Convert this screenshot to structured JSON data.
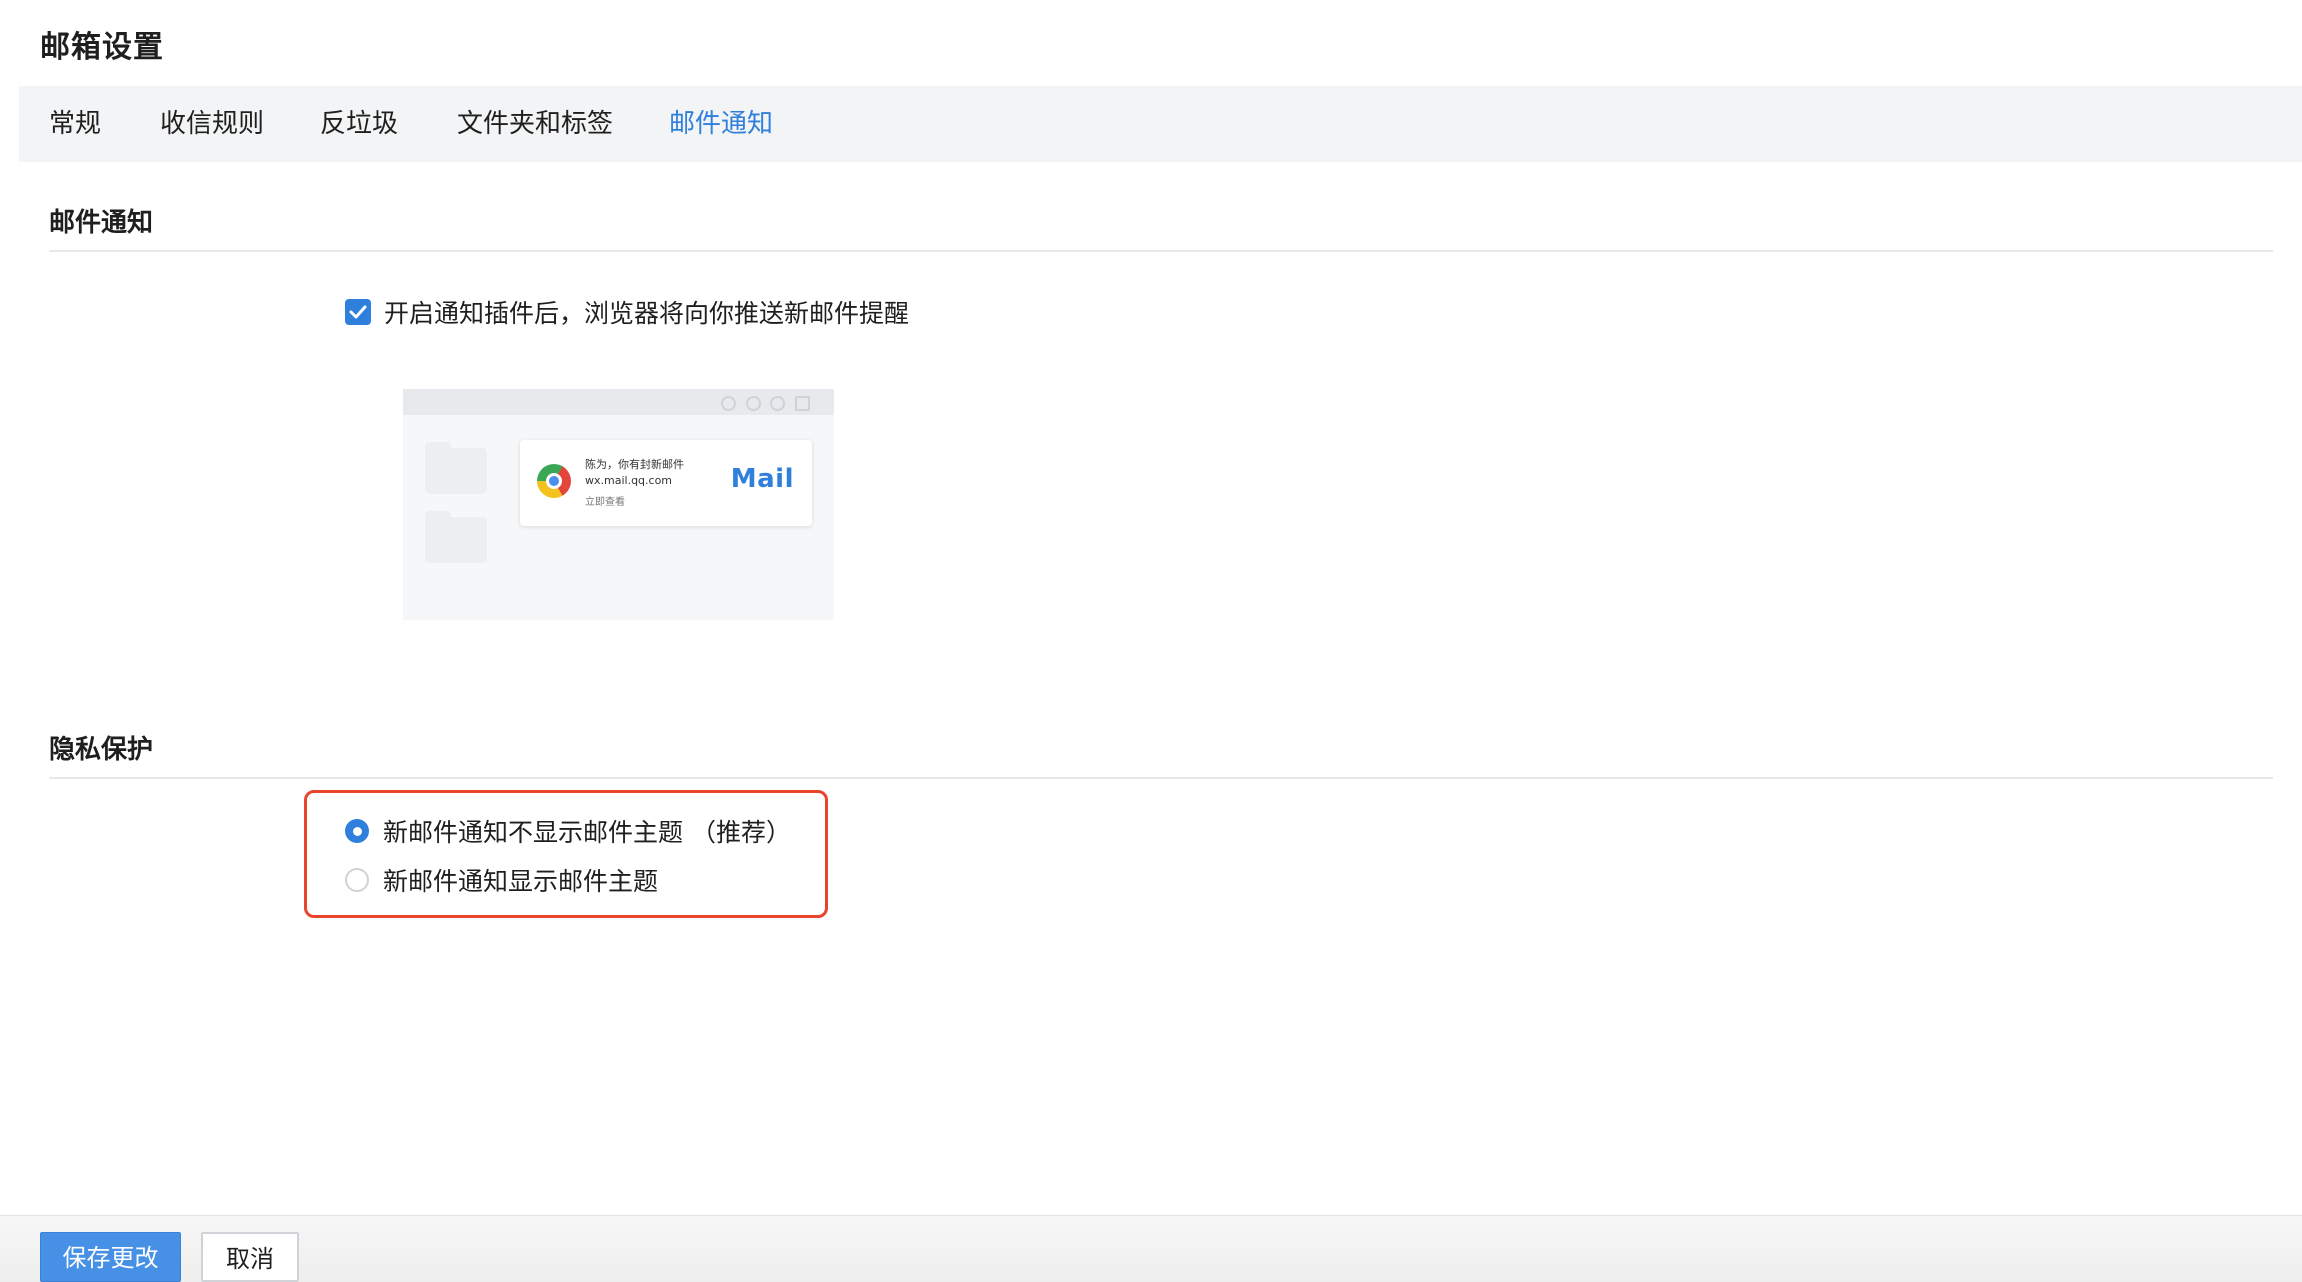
{
  "page": {
    "title": "邮箱设置"
  },
  "tabs": [
    {
      "label": "常规",
      "active": false
    },
    {
      "label": "收信规则",
      "active": false
    },
    {
      "label": "反垃圾",
      "active": false
    },
    {
      "label": "文件夹和标签",
      "active": false
    },
    {
      "label": "邮件通知",
      "active": true
    }
  ],
  "notification_section": {
    "title": "邮件通知",
    "checkbox": {
      "checked": true,
      "label": "开启通知插件后，浏览器将向你推送新邮件提醒"
    },
    "preview": {
      "line1": "陈为，你有封新邮件",
      "line2": "wx.mail.qq.com",
      "line3": "立即查看",
      "logo_text": "Mail",
      "browser_icon": "chrome-icon"
    }
  },
  "privacy_section": {
    "title": "隐私保护",
    "options": [
      {
        "label": "新邮件通知不显示邮件主题 （推荐）",
        "selected": true
      },
      {
        "label": "新邮件通知显示邮件主题",
        "selected": false
      }
    ]
  },
  "footer": {
    "save_label": "保存更改",
    "cancel_label": "取消"
  },
  "colors": {
    "accent": "#2f7fdc",
    "highlight_border": "#e8452c",
    "tabbar_bg": "#f3f4f5"
  }
}
